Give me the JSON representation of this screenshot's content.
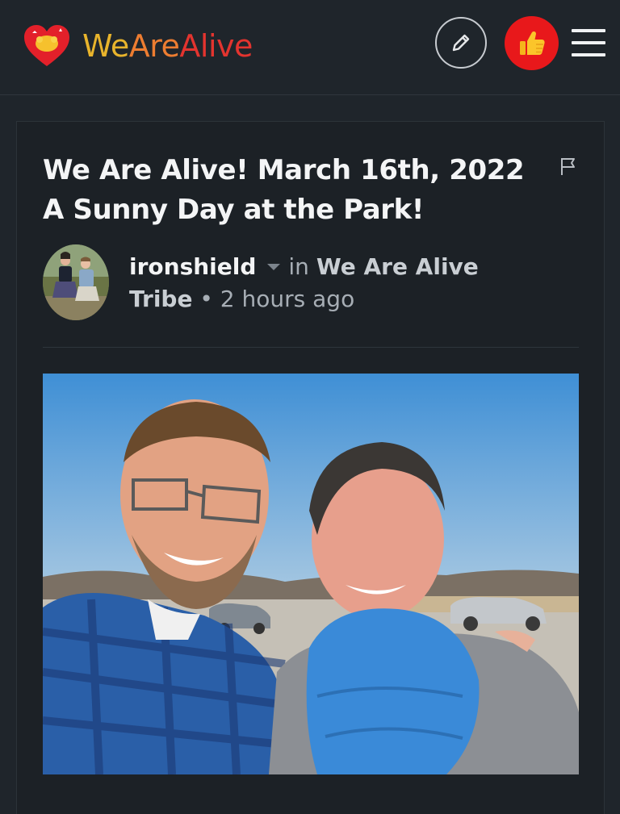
{
  "header": {
    "brand_part1": "We",
    "brand_part2": "Are",
    "brand_part3": "Alive",
    "edit_icon": "pencil-icon",
    "like_icon": "thumbs-up-icon",
    "menu_icon": "hamburger-menu-icon"
  },
  "post": {
    "title": "We Are Alive! March 16th, 2022 A Sunny Day at the Park!",
    "flag_icon": "flag-icon",
    "author": "ironshield",
    "in_label": "in",
    "community": "We Are Alive Tribe",
    "separator": "•",
    "time_ago": "2 hours ago"
  },
  "colors": {
    "background": "#1f252b",
    "card": "#1c2126",
    "like_button": "#e8181b",
    "brand_yellow": "#e8b42c",
    "brand_orange": "#ed7d31",
    "brand_red": "#e3342f"
  }
}
